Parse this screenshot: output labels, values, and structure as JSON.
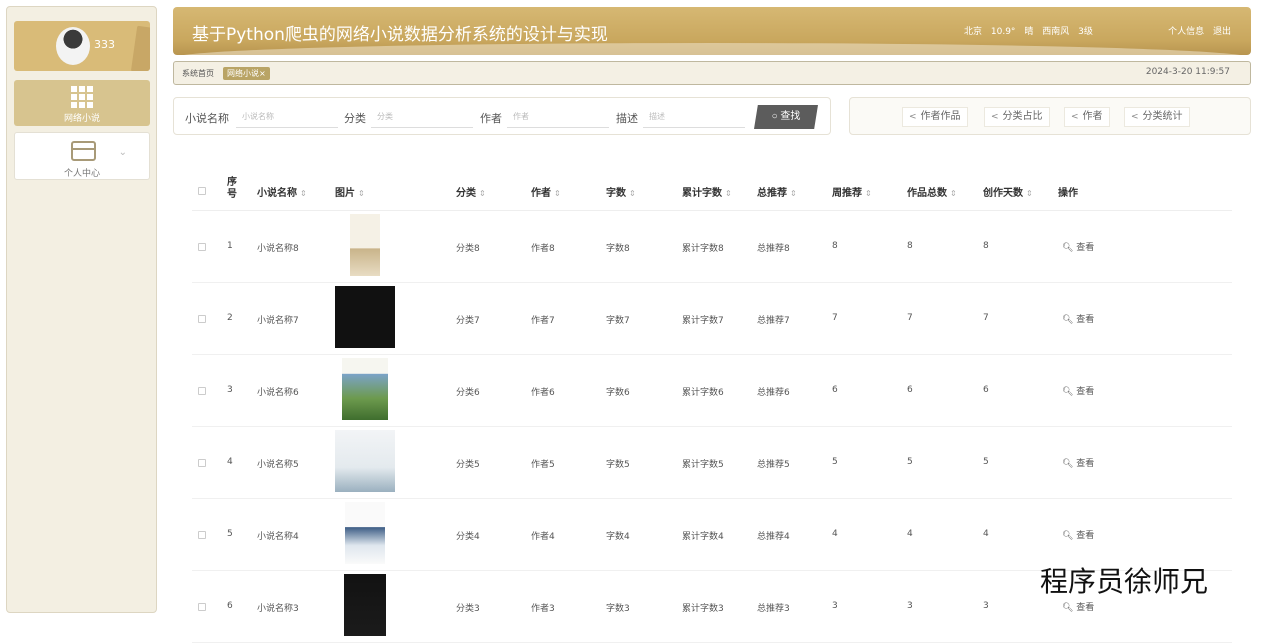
{
  "sidebar": {
    "user": {
      "name": "333"
    },
    "items": [
      {
        "label": "网络小说",
        "icon": "grid-icon"
      },
      {
        "label": "个人中心",
        "icon": "id-card-icon"
      }
    ]
  },
  "header": {
    "title": "基于Python爬虫的网络小说数据分析系统的设计与实现",
    "weather": {
      "city": "北京",
      "temp": "10.9°",
      "condition": "晴",
      "wind": "西南风",
      "level": "3级"
    },
    "profile_link": "个人信息",
    "logout_link": "退出"
  },
  "tabs": {
    "home": "系统首页",
    "active": "网络小说",
    "close": "×",
    "datetime": "2024-3-20 11:9:57"
  },
  "search": {
    "name_label": "小说名称",
    "name_placeholder": "小说名称",
    "category_label": "分类",
    "category_placeholder": "分类",
    "author_label": "作者",
    "author_placeholder": "作者",
    "desc_label": "描述",
    "desc_placeholder": "描述",
    "button": "查找"
  },
  "actions": [
    "作者作品",
    "分类占比",
    "作者",
    "分类统计"
  ],
  "table": {
    "columns": [
      "序号",
      "小说名称",
      "图片",
      "分类",
      "作者",
      "字数",
      "累计字数",
      "总推荐",
      "周推荐",
      "作品总数",
      "创作天数",
      "操作"
    ],
    "rows": [
      {
        "idx": "1",
        "name": "小说名称8",
        "category": "分类8",
        "author": "作者8",
        "words": "字数8",
        "total_words": "累计字数8",
        "total_rec": "总推荐8",
        "week_rec": "8",
        "works": "8",
        "days": "8",
        "action": "查看"
      },
      {
        "idx": "2",
        "name": "小说名称7",
        "category": "分类7",
        "author": "作者7",
        "words": "字数7",
        "total_words": "累计字数7",
        "total_rec": "总推荐7",
        "week_rec": "7",
        "works": "7",
        "days": "7",
        "action": "查看"
      },
      {
        "idx": "3",
        "name": "小说名称6",
        "category": "分类6",
        "author": "作者6",
        "words": "字数6",
        "total_words": "累计字数6",
        "total_rec": "总推荐6",
        "week_rec": "6",
        "works": "6",
        "days": "6",
        "action": "查看"
      },
      {
        "idx": "4",
        "name": "小说名称5",
        "category": "分类5",
        "author": "作者5",
        "words": "字数5",
        "total_words": "累计字数5",
        "total_rec": "总推荐5",
        "week_rec": "5",
        "works": "5",
        "days": "5",
        "action": "查看"
      },
      {
        "idx": "5",
        "name": "小说名称4",
        "category": "分类4",
        "author": "作者4",
        "words": "字数4",
        "total_words": "累计字数4",
        "total_rec": "总推荐4",
        "week_rec": "4",
        "works": "4",
        "days": "4",
        "action": "查看"
      },
      {
        "idx": "6",
        "name": "小说名称3",
        "category": "分类3",
        "author": "作者3",
        "words": "字数3",
        "total_words": "累计字数3",
        "total_rec": "总推荐3",
        "week_rec": "3",
        "works": "3",
        "days": "3",
        "action": "查看"
      }
    ]
  },
  "watermark": "程序员徐师兄",
  "colors": {
    "accent": "#c9a75e",
    "tab_active": "#b9a465",
    "search_button": "#5c5c5c"
  }
}
